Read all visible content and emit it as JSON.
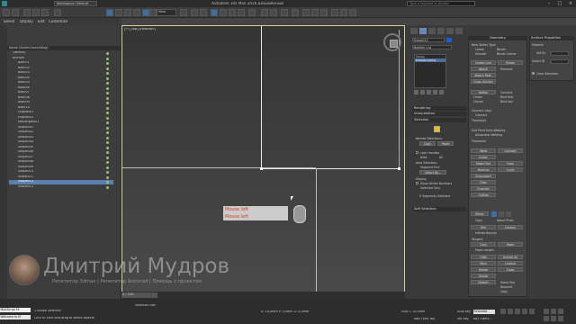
{
  "titlebar": {
    "workspace": "Workspace: Default",
    "menus": [
      "Edit",
      "Tools",
      "Group",
      "Views",
      "Create",
      "Modifiers",
      "Graph Editors",
      "Animation",
      "Rendering",
      "Civil View",
      "Customize",
      "Scripting",
      "Help",
      "Полигон"
    ],
    "title": "Autodesk 3ds Max 2016    Безымянный",
    "search_placeholder": "Type a keyword or phrase"
  },
  "toolbar": {
    "view_dropdown": "View"
  },
  "explorer": {
    "menus": [
      "Select",
      "Display",
      "Edit",
      "Customize"
    ],
    "header": "Name (Sorted Ascending)",
    "rows": [
      "(default)",
      "Archive",
      "Box001",
      "Box002",
      "Box003",
      "Box004",
      "Box005",
      "Box006",
      "Box007",
      "Box008",
      "Box009",
      "Box010",
      "Ellipse001",
      "Ellipse002",
      "Rectangle001",
      "Shape001",
      "Shape002",
      "Shape003",
      "Shape004",
      "Shape005",
      "Shape006",
      "Shape007",
      "Shape008",
      "Shape009",
      "Shape010",
      "Shape011",
      "Shape012",
      "Shape013"
    ],
    "selected_index": 26,
    "layer_footer": "Layer Explorer"
  },
  "viewport": {
    "label": "[+] [Top] [Realistic]",
    "mouse_lines": [
      "Mouse left",
      "Mouse left"
    ]
  },
  "cmdpanel": {
    "object_name": "Shape013",
    "modifier_list_label": "Modifier List",
    "stack": [
      "Sweep",
      "Editable Spline"
    ],
    "rollouts": {
      "rendering": "Rendering",
      "interpolation": "Interpolation",
      "selection": "Selection",
      "soft_selection": "Soft Selection",
      "geometry": "Geometry",
      "surface_properties": "Surface Properties"
    },
    "geometry": {
      "new_vertex_type": "New Vertex Type",
      "linear": "Linear",
      "bezier": "Bezier",
      "smooth": "Smooth",
      "bezier_corner": "Bezier Corner",
      "create_line": "Create Line",
      "break": "Break",
      "attach": "Attach",
      "reorient": "Reorient",
      "attach_mult": "Attach Mult.",
      "cross_section": "Cross Section",
      "refine": "Refine",
      "connect": "Connect",
      "linear2": "Linear",
      "bind_first": "Bind first",
      "closed": "Closed",
      "bind_last": "Bind last",
      "connect_copy": "Connect Copy",
      "connect2": "Connect",
      "threshold": "Threshold",
      "end_point_auto_welding": "End Point Auto-Welding",
      "automatic_welding": "Automatic Welding",
      "threshold2": "Threshold",
      "weld": "Weld",
      "connect3": "Connect",
      "insert": "Insert",
      "make_first": "Make First",
      "fuse": "Fuse",
      "reverse": "Reverse",
      "cycle": "Cycle",
      "crossinsert": "CrossInsert",
      "fillet": "Fillet",
      "chamfer": "Chamfer",
      "outline": "Outline",
      "mirror": "Mirror",
      "copy": "Copy",
      "about_pivot": "About Pivot",
      "trim": "Trim",
      "extend": "Extend",
      "infinite_bounds": "Infinite Bounds",
      "tangent": "Tangent",
      "copy2": "Copy",
      "paste": "Paste",
      "paste_length": "Paste Length",
      "hide": "Hide",
      "unhide_all": "Unhide All",
      "bind": "Bind",
      "unbind": "Unbind",
      "delete": "Delete",
      "close": "Close",
      "divide": "Divide",
      "detach": "Detach",
      "same_shp": "Same Shp",
      "reorient2": "Reorient",
      "copy3": "Copy",
      "explode": "Explode",
      "to_splines": "Splines",
      "to_objects": "Objects"
    },
    "surface": {
      "material": "Material",
      "set_id": "Set ID:",
      "select_id": "Select ID",
      "clear_selection": "Clear Selection"
    },
    "selection": {
      "named_selections": "Named Selections:",
      "copy": "Copy",
      "paste": "Paste",
      "lock_handles": "Lock Handles",
      "alike": "Alike",
      "all": "All",
      "area_selection": "Area Selection:",
      "segment_end": "Segment End",
      "select_by": "Select By...",
      "display": "Display",
      "show_vertex_numbers": "Show Vertex Numbers",
      "selected_only": "Selected Only",
      "status": "0 Segments Selected"
    }
  },
  "timeline": {
    "position": "0 / 100"
  },
  "status": {
    "maxscript": "MAXScript Mi",
    "welcome": "Welcome to M",
    "selection_status": "1 Shape Selected",
    "prompt": "Click or click-and-drag to select objects",
    "selection_set": "Selection Set:",
    "coords": "X: 18,0mm  Y: 0,0mm  Z: 0,0mm",
    "grid": "Grid = 10,0mm",
    "auto_key": "Auto Key",
    "selected": "Selected",
    "set_key": "Set Key",
    "key_filters": "Key Filters...",
    "add_time_tag": "Add Time Tag"
  },
  "watermark": {
    "name": "Дмитрий Мудров",
    "subtitle": "Репетитор 3dmax | Репетитор Archicad | Помощь с проектом"
  }
}
